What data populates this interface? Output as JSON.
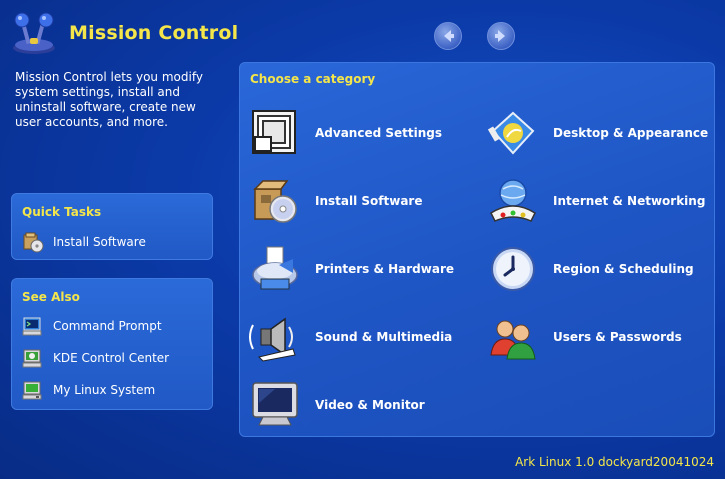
{
  "app": {
    "title": "Mission Control",
    "logo_icon": "joystick-icon"
  },
  "nav": {
    "back_icon": "arrow-left-icon",
    "forward_icon": "arrow-right-icon"
  },
  "intro": {
    "text": "Mission Control lets you modify system settings, install and uninstall software, create new user accounts, and more."
  },
  "quick_tasks": {
    "title": "Quick Tasks",
    "items": [
      {
        "label": "Install Software",
        "icon": "install-software-icon"
      }
    ]
  },
  "see_also": {
    "title": "See Also",
    "items": [
      {
        "label": "Command Prompt",
        "icon": "terminal-icon"
      },
      {
        "label": "KDE Control Center",
        "icon": "kde-control-center-icon"
      },
      {
        "label": "My Linux System",
        "icon": "linux-system-icon"
      }
    ]
  },
  "categories": {
    "title": "Choose a category",
    "items": [
      {
        "label": "Advanced Settings",
        "icon": "advanced-settings-icon"
      },
      {
        "label": "Desktop & Appearance",
        "icon": "desktop-appearance-icon"
      },
      {
        "label": "Install Software",
        "icon": "install-software-icon"
      },
      {
        "label": "Internet & Networking",
        "icon": "network-icon"
      },
      {
        "label": "Printers & Hardware",
        "icon": "printer-icon"
      },
      {
        "label": "Region & Scheduling",
        "icon": "clock-icon"
      },
      {
        "label": "Sound & Multimedia",
        "icon": "speaker-icon"
      },
      {
        "label": "Users & Passwords",
        "icon": "users-icon"
      },
      {
        "label": "Video & Monitor",
        "icon": "monitor-icon"
      }
    ]
  },
  "footer": {
    "version": "Ark Linux 1.0 dockyard20041024"
  },
  "colors": {
    "accent_yellow": "#f4e64a",
    "background": "#0b3aa8",
    "panel": "#2159c6"
  }
}
